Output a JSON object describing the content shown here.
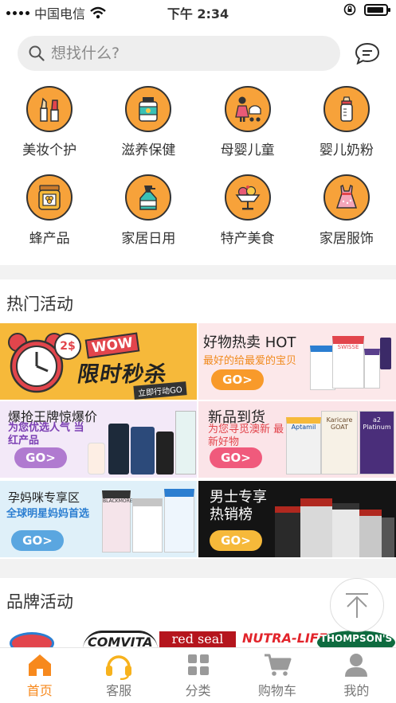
{
  "status": {
    "carrier": "中国电信",
    "time": "下午 2:34"
  },
  "search": {
    "placeholder": "想找什么?"
  },
  "categories": [
    {
      "label": "美妆个护",
      "icon": "makeup-icon"
    },
    {
      "label": "滋养保健",
      "icon": "supplement-bottle-icon"
    },
    {
      "label": "母婴儿童",
      "icon": "mother-baby-icon"
    },
    {
      "label": "婴儿奶粉",
      "icon": "baby-bottle-icon"
    },
    {
      "label": "蜂产品",
      "icon": "honey-jar-icon"
    },
    {
      "label": "家居日用",
      "icon": "household-bottle-icon"
    },
    {
      "label": "特产美食",
      "icon": "ice-cream-icon"
    },
    {
      "label": "家居服饰",
      "icon": "dress-icon"
    }
  ],
  "hot": {
    "title": "热门活动",
    "flash_sale": {
      "badge": "2$",
      "wow": "WOW",
      "title": "限时秒杀",
      "tag": "立即行动GO"
    },
    "tiles": [
      {
        "title": "好物热卖 HOT",
        "subtitle": "最好的给最爱的宝贝",
        "go": "GO>"
      },
      {
        "title": "爆抢王牌惊爆价",
        "subtitle": "为您优选人气 当红产品",
        "go": "GO>"
      },
      {
        "title": "新品到货",
        "subtitle": "为您寻觅澳新 最新好物",
        "go": "GO>"
      },
      {
        "title": "孕妈咪专享区",
        "subtitle": "全球明星妈妈首选",
        "go": "GO>"
      },
      {
        "title": "男士专享 热销榜",
        "subtitle": "",
        "go": "GO>"
      }
    ],
    "product_labels": [
      "SWISSE",
      "Aptamil",
      "Karicare GOAT",
      "a2 Platinum",
      "BLACKMORES",
      "GOAT"
    ]
  },
  "brand_section": {
    "title": "品牌活动",
    "brands": [
      "COMVITA",
      "red seal",
      "NUTRA-LIFE",
      "THOMPSON'S"
    ]
  },
  "colors": {
    "accent": "#f7891d",
    "tile_go": "#f89a2a",
    "flash_bg": "#f6b93a",
    "pink": "#fbe4e8"
  },
  "tabbar": [
    {
      "label": "首页",
      "icon": "home-icon",
      "active": true
    },
    {
      "label": "客服",
      "icon": "headset-icon",
      "active": false
    },
    {
      "label": "分类",
      "icon": "grid-icon",
      "active": false
    },
    {
      "label": "购物车",
      "icon": "cart-icon",
      "active": false
    },
    {
      "label": "我的",
      "icon": "user-icon",
      "active": false
    }
  ]
}
